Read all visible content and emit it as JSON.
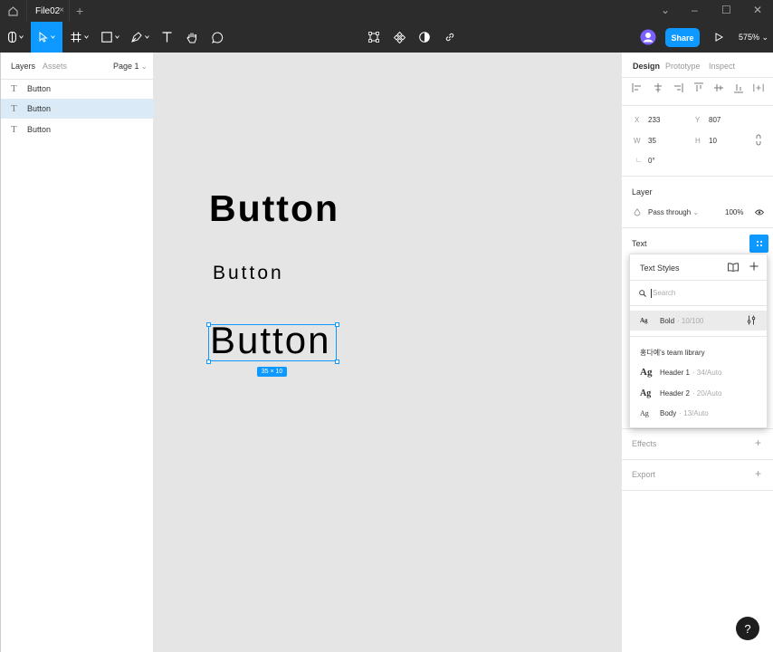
{
  "tabbar": {
    "file_tab": "File02",
    "close": "×",
    "plus": "+"
  },
  "toolbar": {
    "share_label": "Share",
    "zoom": "575%"
  },
  "left_panel": {
    "tabs": [
      "Layers",
      "Assets"
    ],
    "page_selector": "Page 1",
    "layers": [
      {
        "label": "Button",
        "selected": false
      },
      {
        "label": "Button",
        "selected": true
      },
      {
        "label": "Button",
        "selected": false
      }
    ]
  },
  "canvas": {
    "texts": [
      "Button",
      "Button",
      "Button"
    ],
    "dimension_badge": "35 × 10"
  },
  "right_panel": {
    "tabs": [
      "Design",
      "Prototype",
      "Inspect"
    ],
    "x_label": "X",
    "x_value": "233",
    "y_label": "Y",
    "y_value": "807",
    "w_label": "W",
    "w_value": "35",
    "h_label": "H",
    "h_value": "10",
    "rotation": "0°",
    "layer_title": "Layer",
    "blend_mode": "Pass through",
    "opacity": "100%",
    "text_title": "Text",
    "effects_title": "Effects",
    "export_title": "Export"
  },
  "text_styles_popover": {
    "title": "Text Styles",
    "search_placeholder": "Search",
    "local_styles": [
      {
        "ag": "Ag",
        "name": "Bold",
        "meta": "· 10/100"
      }
    ],
    "library_title": "홍다예's team library",
    "library_styles": [
      {
        "ag": "Ag",
        "name": "Header 1",
        "meta": "· 34/Auto"
      },
      {
        "ag": "Ag",
        "name": "Header 2",
        "meta": "· 20/Auto"
      },
      {
        "ag": "Ag",
        "name": "Body",
        "meta": "· 13/Auto"
      }
    ]
  },
  "help": "?",
  "colors": {
    "accent": "#0d99ff",
    "toolbar_bg": "#2c2c2c",
    "canvas_bg": "#e5e5e5"
  }
}
